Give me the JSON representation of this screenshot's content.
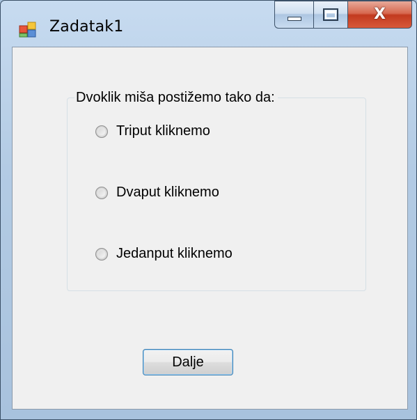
{
  "window": {
    "title": "Zadatak1",
    "close_symbol": "X"
  },
  "icons": {
    "app": "app-window-icon",
    "minimize": "minimize-icon",
    "maximize": "maximize-icon",
    "close": "close-icon"
  },
  "group": {
    "legend": "Dvoklik miša postižemo tako da:",
    "options": [
      {
        "label": "Triput kliknemo",
        "checked": false
      },
      {
        "label": "Dvaput kliknemo",
        "checked": false
      },
      {
        "label": "Jedanput kliknemo",
        "checked": false
      }
    ]
  },
  "actions": {
    "next_label": "Dalje"
  },
  "colors": {
    "client_background": "#f0f0f0",
    "close_button": "#c23a1f",
    "button_focus_border": "#3c7fb1"
  }
}
